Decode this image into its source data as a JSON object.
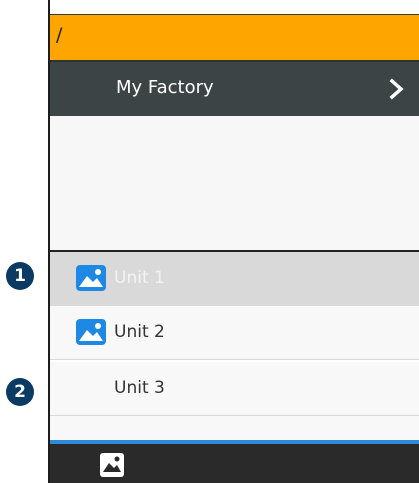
{
  "topbar": {
    "path": "/"
  },
  "header": {
    "title": "My Factory",
    "chevron_icon": "chevron-right-icon"
  },
  "list": {
    "items": [
      {
        "label": "Unit 1",
        "icon": "image-icon",
        "selected": true
      },
      {
        "label": "Unit 2",
        "icon": "image-icon",
        "selected": false
      },
      {
        "label": "Unit 3",
        "icon": null,
        "selected": false
      }
    ]
  },
  "bottombar": {
    "button_icon": "image-icon"
  },
  "markers": [
    "1",
    "2"
  ],
  "colors": {
    "topbar": "#FFA500",
    "header": "#3d4446",
    "selected_row": "#d9d9d9",
    "accent_line": "#2e8bd9",
    "icon_blue": "#1e88e5",
    "marker": "#0b3a63"
  }
}
